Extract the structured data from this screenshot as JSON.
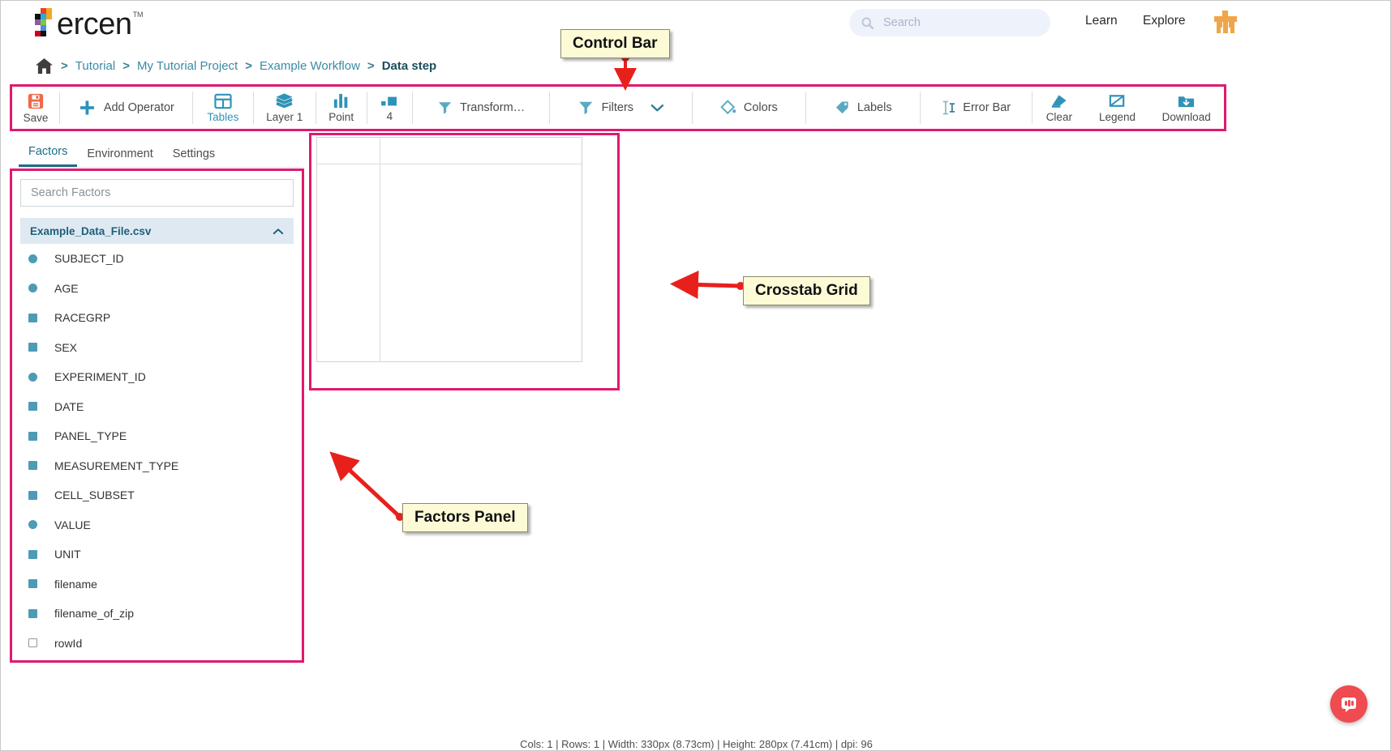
{
  "app": {
    "logo_text": "ercen",
    "logo_tm": "TM",
    "logo_colors": [
      "#e8402a",
      "#f5a623",
      "#7ac943",
      "#29abe2",
      "#8e44ad",
      "#111111",
      "#d0021b",
      "#4a90d9"
    ]
  },
  "header": {
    "search": {
      "placeholder": "Search",
      "value": ""
    },
    "nav": [
      {
        "label": "Learn",
        "name": "nav-learn"
      },
      {
        "label": "Explore",
        "name": "nav-explore"
      }
    ],
    "avatar_color": "#f0a548"
  },
  "breadcrumb": {
    "home_icon": "home-icon",
    "separator": ">",
    "items": [
      {
        "label": "Tutorial",
        "current": false
      },
      {
        "label": "My Tutorial Project",
        "current": false
      },
      {
        "label": "Example Workflow",
        "current": false
      },
      {
        "label": "Data step",
        "current": true
      }
    ]
  },
  "control_bar": {
    "items": [
      {
        "name": "save-button",
        "icon": "save-icon",
        "label": "Save",
        "accent": false
      },
      {
        "name": "add-operator-button",
        "icon": "plus-icon",
        "label": "Add Operator",
        "accent": false
      },
      {
        "name": "tables-button",
        "icon": "table-grid-icon",
        "label": "Tables",
        "accent": true
      },
      {
        "name": "layer-button",
        "icon": "layers-icon",
        "label": "Layer 1",
        "accent": false
      },
      {
        "name": "point-button",
        "icon": "bar-chart-icon",
        "label": "Point",
        "accent": false
      },
      {
        "name": "size-button",
        "icon": "size-squares-icon",
        "label": "4",
        "accent": false
      },
      {
        "name": "transform-button",
        "icon": "funnel-icon",
        "label": "Transform…",
        "accent": false
      },
      {
        "name": "filters-button",
        "icon": "funnel-icon",
        "label": "Filters",
        "accent": false
      },
      {
        "name": "colors-button",
        "icon": "paint-drop-icon",
        "label": "Colors",
        "accent": false
      },
      {
        "name": "labels-button",
        "icon": "tag-icon",
        "label": "Labels",
        "accent": false
      },
      {
        "name": "error-bar-button",
        "icon": "error-bar-icon",
        "label": "Error Bar",
        "accent": false
      },
      {
        "name": "clear-button",
        "icon": "eraser-icon",
        "label": "Clear",
        "accent": false
      },
      {
        "name": "legend-button",
        "icon": "legend-icon",
        "label": "Legend",
        "accent": false
      },
      {
        "name": "download-button",
        "icon": "download-folder-icon",
        "label": "Download",
        "accent": false
      }
    ],
    "highlight_color": "#e0196f"
  },
  "left_panel": {
    "tabs": [
      {
        "label": "Factors",
        "active": true
      },
      {
        "label": "Environment",
        "active": false
      },
      {
        "label": "Settings",
        "active": false
      }
    ],
    "search": {
      "placeholder": "Search Factors",
      "value": ""
    },
    "file": {
      "name": "Example_Data_File.csv",
      "expanded": true,
      "chevron": "chevron-up-icon"
    },
    "factors": [
      {
        "label": "SUBJECT_ID",
        "marker": "circle"
      },
      {
        "label": "AGE",
        "marker": "circle"
      },
      {
        "label": "RACEGRP",
        "marker": "square"
      },
      {
        "label": "SEX",
        "marker": "square"
      },
      {
        "label": "EXPERIMENT_ID",
        "marker": "circle"
      },
      {
        "label": "DATE",
        "marker": "square"
      },
      {
        "label": "PANEL_TYPE",
        "marker": "square"
      },
      {
        "label": "MEASUREMENT_TYPE",
        "marker": "square"
      },
      {
        "label": "CELL_SUBSET",
        "marker": "square"
      },
      {
        "label": "VALUE",
        "marker": "circle"
      },
      {
        "label": "UNIT",
        "marker": "square"
      },
      {
        "label": "filename",
        "marker": "square"
      },
      {
        "label": "filename_of_zip",
        "marker": "square"
      },
      {
        "label": "rowId",
        "marker": "hollow"
      }
    ]
  },
  "status_bar": {
    "text": "Cols: 1 | Rows: 1 | Width: 330px (8.73cm) | Height: 280px (7.41cm) | dpi: 96"
  },
  "annotations": [
    {
      "name": "callout-control-bar",
      "label": "Control Bar"
    },
    {
      "name": "callout-crosstab-grid",
      "label": "Crosstab Grid"
    },
    {
      "name": "callout-factors-panel",
      "label": "Factors Panel"
    }
  ],
  "annotation_color": "#e8201c",
  "intercom": {
    "icon": "chat-bubble-icon",
    "color": "#ef4b50"
  }
}
